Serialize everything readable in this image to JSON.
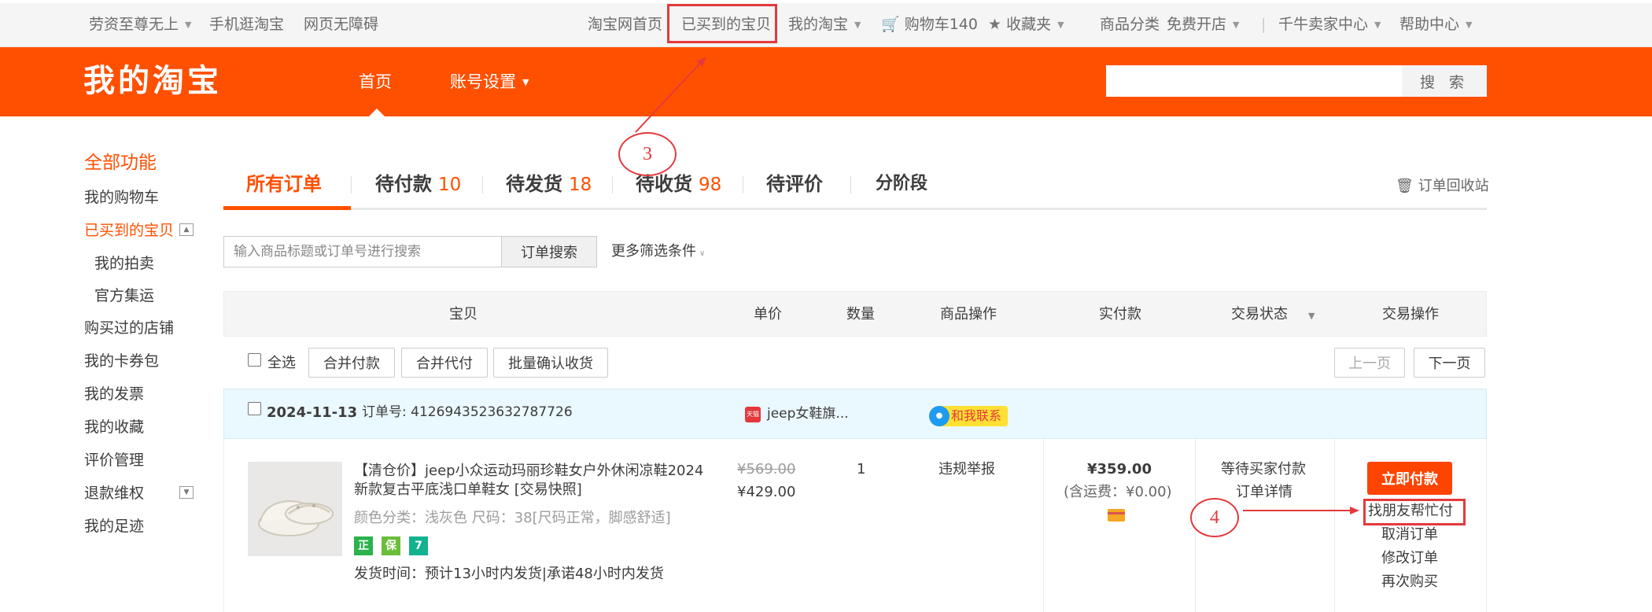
{
  "topbar": {
    "user": "劳资至尊无上",
    "mobile": "手机逛淘宝",
    "accessible": "网页无障碍",
    "home": "淘宝网首页",
    "bought": "已买到的宝贝",
    "my_taobao": "我的淘宝",
    "cart": "购物车140",
    "favorites": "收藏夹",
    "categories": "商品分类",
    "open_shop": "免费开店",
    "seller_center": "千牛卖家中心",
    "help_center": "帮助中心"
  },
  "header": {
    "logo": "我的淘宝",
    "nav_home": "首页",
    "nav_account": "账号设置",
    "search_placeholder": "",
    "search_button": "搜 索"
  },
  "sidebar": {
    "title": "全部功能",
    "items": [
      "我的购物车",
      "已买到的宝贝",
      "我的拍卖",
      "官方集运",
      "购买过的店铺",
      "我的卡券包",
      "我的发票",
      "我的收藏",
      "评价管理",
      "退款维权",
      "我的足迹"
    ]
  },
  "tabs": [
    {
      "label": "所有订单",
      "count": ""
    },
    {
      "label": "待付款",
      "count": "10"
    },
    {
      "label": "待发货",
      "count": "18"
    },
    {
      "label": "待收货",
      "count": "98"
    },
    {
      "label": "待评价",
      "count": ""
    },
    {
      "label": "分阶段",
      "count": ""
    }
  ],
  "recycle_bin": "订单回收站",
  "order_search": {
    "placeholder": "输入商品标题或订单号进行搜索",
    "button": "订单搜索",
    "more_filters": "更多筛选条件"
  },
  "table_header": {
    "item": "宝贝",
    "unit_price": "单价",
    "quantity": "数量",
    "item_ops": "商品操作",
    "paid": "实付款",
    "status": "交易状态",
    "trade_ops": "交易操作"
  },
  "bulk": {
    "select_all": "全选",
    "merge_pay": "合并付款",
    "merge_proxy": "合并代付",
    "batch_confirm": "批量确认收货",
    "prev_page": "上一页",
    "next_page": "下一页"
  },
  "order": {
    "date": "2024-11-13",
    "order_no": "订单号: 4126943523632787726",
    "shop_badge": "天猫",
    "shop": "jeep女鞋旗...",
    "contact": "和我联系",
    "title_line1": "【清仓价】jeep小众运动玛丽珍鞋女户外休闲凉鞋2024",
    "title_line2": "新款复古平底浅口单鞋女 [交易快照]",
    "sku": "颜色分类：浅灰色  尺码：38[尺码正常，脚感舒适]",
    "badges": [
      "正",
      "保",
      "7"
    ],
    "ship_time": "发货时间：预计13小时内发货|承诺48小时内发货",
    "original_price": "¥569.00",
    "price": "¥429.00",
    "quantity": "1",
    "report": "违规举报",
    "paid": "¥359.00",
    "shipping": "(含运费：¥0.00)",
    "status": "等待买家付款",
    "detail": "订单详情",
    "pay_now": "立即付款",
    "ask_friend": "找朋友帮忙付",
    "cancel": "取消订单",
    "modify": "修改订单",
    "rebuy": "再次购买"
  },
  "annotations": {
    "step3": "3",
    "step4": "4"
  },
  "colors": {
    "brand": "#ff5000",
    "annotation": "#e4393c",
    "order_bg": "#eaf8ff"
  }
}
